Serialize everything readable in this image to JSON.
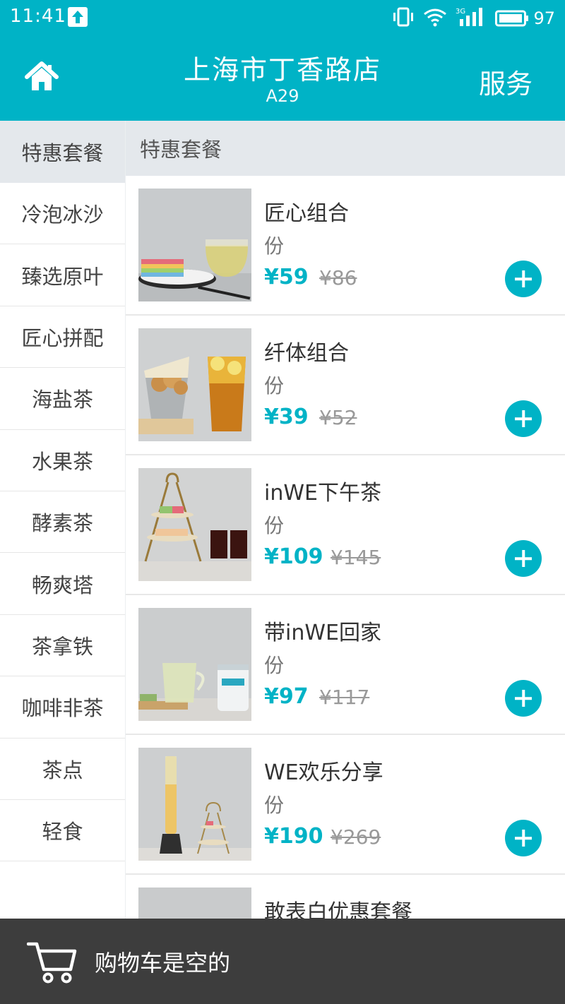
{
  "status": {
    "time": "11:41",
    "network": "3G",
    "battery": "97"
  },
  "header": {
    "store_name": "上海市丁香路店",
    "table_no": "A29",
    "service_label": "服务"
  },
  "categories": [
    "特惠套餐",
    "冷泡冰沙",
    "臻选原叶",
    "匠心拼配",
    "海盐茶",
    "水果茶",
    "酵素茶",
    "畅爽塔",
    "茶拿铁",
    "咖啡非茶",
    "茶点",
    "轻食"
  ],
  "section_title": "特惠套餐",
  "items": [
    {
      "name": "匠心组合",
      "unit": "份",
      "price": "¥59",
      "orig_price": "¥86"
    },
    {
      "name": "纤体组合",
      "unit": "份",
      "price": "¥39",
      "orig_price": "¥52"
    },
    {
      "name": "inWE下午茶",
      "unit": "份",
      "price": "¥109",
      "orig_price": "¥145"
    },
    {
      "name": "带inWE回家",
      "unit": "份",
      "price": "¥97",
      "orig_price": "¥117"
    },
    {
      "name": "WE欢乐分享",
      "unit": "份",
      "price": "¥190",
      "orig_price": "¥269"
    },
    {
      "name": "敢表白优惠套餐"
    }
  ],
  "cart": {
    "empty_text": "购物车是空的"
  },
  "colors": {
    "accent": "#00b3c6",
    "cart_bar": "#3d3d3d",
    "section_bg": "#e4e8ec"
  }
}
